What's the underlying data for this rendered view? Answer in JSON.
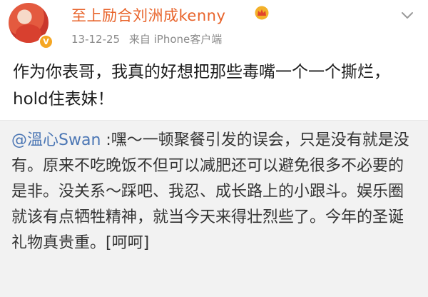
{
  "post": {
    "username": "至上励合刘洲成kenny",
    "date": "13-12-25",
    "source": "来自 iPhone客户端",
    "text": "作为你表哥，我真的好想把那些毒嘴一个一个撕烂，hold住表妹！",
    "icons": {
      "avatar": "avatar",
      "verified": "verified-badge-icon",
      "crown": "crown-icon",
      "menu": "chevron-down-icon"
    },
    "verified_mark": "V"
  },
  "repost": {
    "mention": "@溫心Swan",
    "text": " :嘿～一顿聚餐引发的误会，只是没有就是没有。原来不吃晚饭不但可以减肥还可以避免很多不必要的是非。没关系～踩吧、我忍、成长路上的小跟斗。娱乐圈就该有点牺牲精神，就当今天来得壮烈些了。今年的圣诞礼物真贵重。[呵呵]"
  },
  "colors": {
    "username": "#e8632a",
    "mention": "#4b76b4",
    "repost_bg": "#f2f2f2",
    "verified": "#f5a623"
  }
}
